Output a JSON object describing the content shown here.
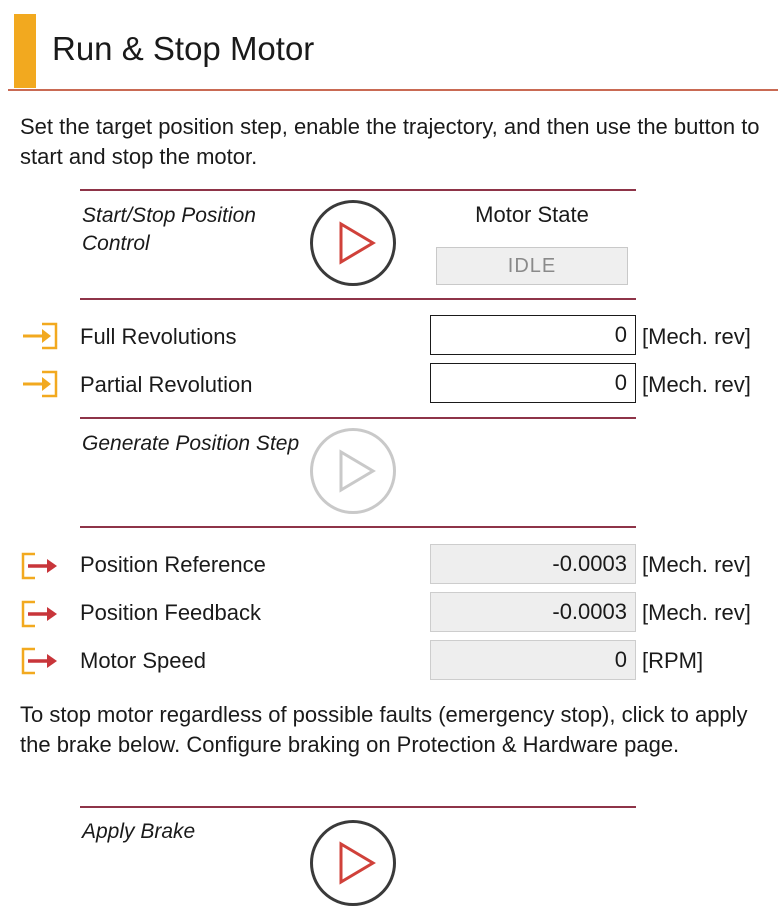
{
  "header": {
    "title": "Run & Stop Motor",
    "accent_color": "#f2a91f",
    "rule_color": "#c96a54"
  },
  "intro_text": "Set the target position step, enable the trajectory, and then use the button to start and stop the motor.",
  "start_stop": {
    "label": "Start/Stop Position Control",
    "button_icon": "play-icon",
    "motor_state_label": "Motor State",
    "motor_state_value": "IDLE"
  },
  "inputs": [
    {
      "label": "Full Revolutions",
      "value": "0",
      "unit": "[Mech. rev]",
      "icon": "input-arrow-icon"
    },
    {
      "label": "Partial Revolution",
      "value": "0",
      "unit": "[Mech. rev]",
      "icon": "input-arrow-icon"
    }
  ],
  "generate_step": {
    "label": "Generate Position Step",
    "button_icon": "play-icon",
    "enabled": false
  },
  "outputs": [
    {
      "label": "Position Reference",
      "value": "-0.0003",
      "unit": "[Mech. rev]",
      "icon": "output-arrow-icon"
    },
    {
      "label": "Position Feedback",
      "value": "-0.0003",
      "unit": "[Mech. rev]",
      "icon": "output-arrow-icon"
    },
    {
      "label": "Motor Speed",
      "value": "0",
      "unit": "[RPM]",
      "icon": "output-arrow-icon"
    }
  ],
  "brake_text": "To stop motor regardless of possible faults (emergency stop), click to apply the brake below. Configure braking on Protection & Hardware page.",
  "brake": {
    "label": "Apply Brake",
    "button_icon": "play-icon"
  },
  "colors": {
    "separator": "#8e3448",
    "play_active": "#d0413a",
    "play_disabled": "#c9c9c9",
    "icon_orange": "#f2a91f",
    "icon_red": "#c8353a"
  }
}
